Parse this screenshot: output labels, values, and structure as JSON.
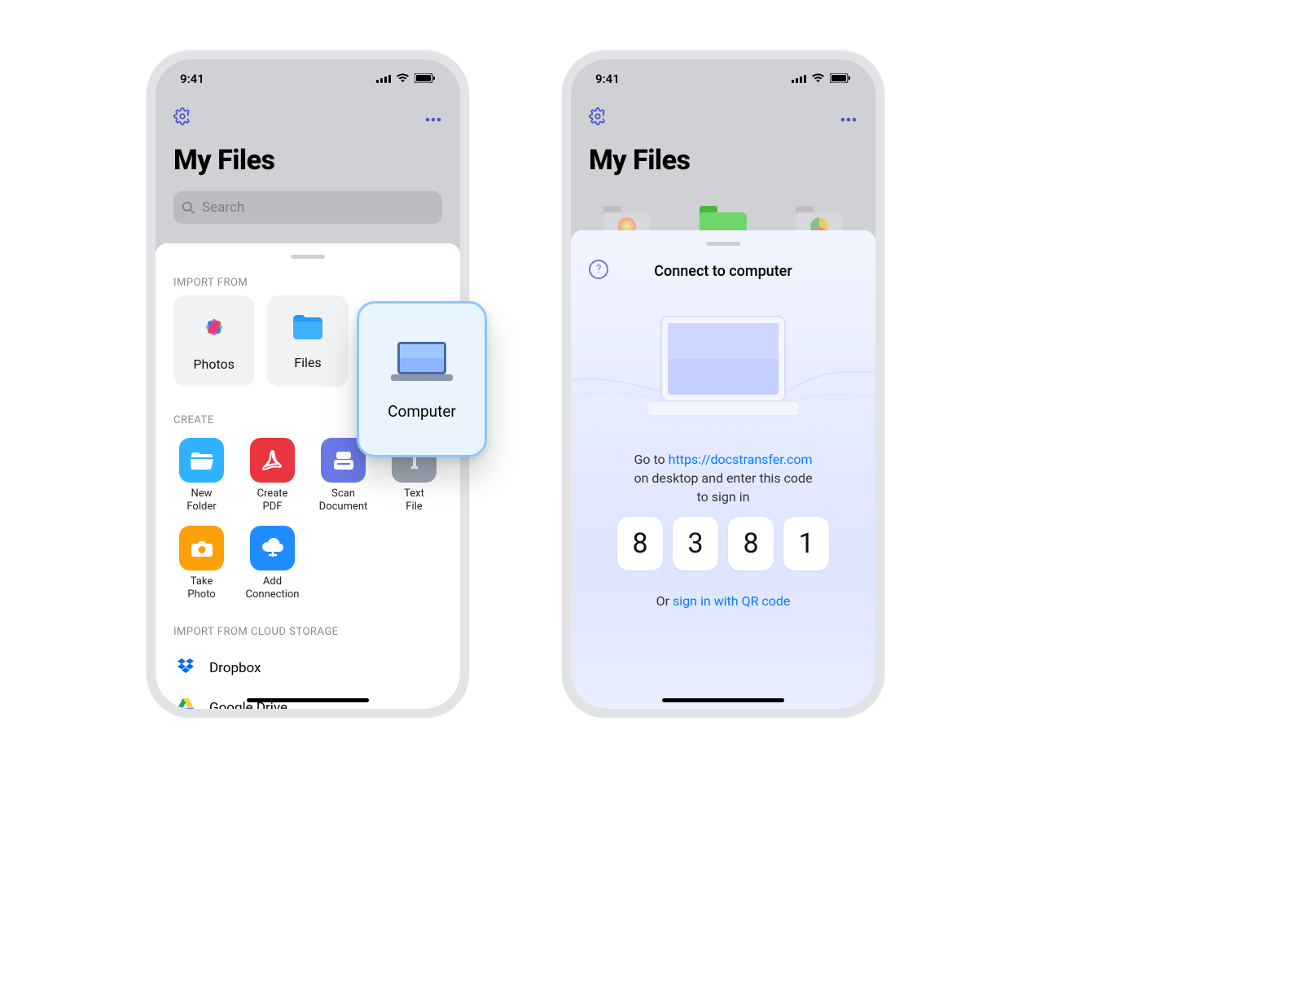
{
  "status": {
    "time": "9:41"
  },
  "header": {
    "title": "My Files",
    "search_placeholder": "Search"
  },
  "import_sheet": {
    "section_import": "IMPORT FROM",
    "sources": {
      "photos": "Photos",
      "files": "Files",
      "computer": "Computer"
    },
    "section_create": "CREATE",
    "create": {
      "new_folder": "New\nFolder",
      "create_pdf": "Create\nPDF",
      "scan_document": "Scan\nDocument",
      "text_file": "Text\nFile",
      "take_photo": "Take\nPhoto",
      "add_connection": "Add\nConnection"
    },
    "section_cloud": "IMPORT FROM CLOUD STORAGE",
    "cloud": {
      "dropbox": "Dropbox",
      "google_drive": "Google Drive"
    }
  },
  "connect_sheet": {
    "title": "Connect to computer",
    "instruction_prefix": "Go to ",
    "instruction_url": "https://docstransfer.com",
    "instruction_suffix_1": "on desktop and enter this code",
    "instruction_suffix_2": "to sign in",
    "code": [
      "8",
      "3",
      "8",
      "1"
    ],
    "alt_prefix": "Or ",
    "alt_link": "sign in with QR code"
  }
}
